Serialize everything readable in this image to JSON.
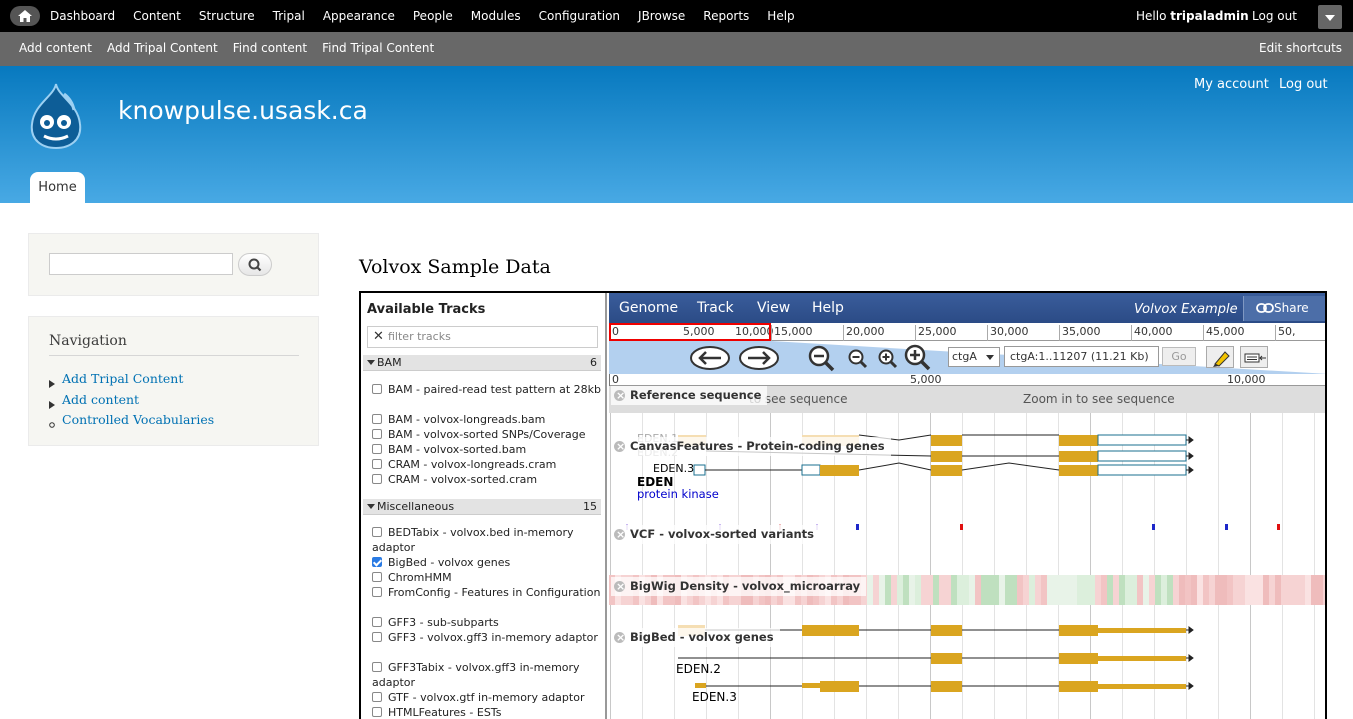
{
  "admin_bar": {
    "menu": [
      "Dashboard",
      "Content",
      "Structure",
      "Tripal",
      "Appearance",
      "People",
      "Modules",
      "Configuration",
      "JBrowse",
      "Reports",
      "Help"
    ],
    "greeting_prefix": "Hello ",
    "username": "tripaladmin",
    "logout": "Log out"
  },
  "shortcuts": {
    "links": [
      "Add content",
      "Add Tripal Content",
      "Find content",
      "Find Tripal Content"
    ],
    "edit": "Edit shortcuts"
  },
  "header": {
    "site_name": "knowpulse.usask.ca",
    "my_account": "My account",
    "log_out": "Log out",
    "home_tab": "Home"
  },
  "sidebar": {
    "search_value": "",
    "nav_title": "Navigation",
    "nav_items": [
      "Add Tripal Content",
      "Add content",
      "Controlled Vocabularies"
    ]
  },
  "page_title": "Volvox Sample Data",
  "jbrowse": {
    "available_tracks": "Available Tracks",
    "filter_placeholder": "filter tracks",
    "categories": [
      {
        "name": "BAM",
        "count": "6"
      },
      {
        "name": "Miscellaneous",
        "count": "15"
      }
    ],
    "bam_tracks": [
      {
        "label": "BAM - paired-read test pattern at 28kb",
        "checked": false
      },
      {
        "label": "BAM - volvox-longreads.bam",
        "checked": false
      },
      {
        "label": "BAM - volvox-sorted SNPs/Coverage",
        "checked": false
      },
      {
        "label": "BAM - volvox-sorted.bam",
        "checked": false
      },
      {
        "label": "CRAM - volvox-longreads.cram",
        "checked": false
      },
      {
        "label": "CRAM - volvox-sorted.cram",
        "checked": false
      }
    ],
    "misc_tracks": [
      {
        "label": "BEDTabix - volvox.bed in-memory adaptor",
        "checked": false
      },
      {
        "label": "BigBed - volvox genes",
        "checked": true
      },
      {
        "label": "ChromHMM",
        "checked": false
      },
      {
        "label": "FromConfig - Features in Configuration",
        "checked": false
      },
      {
        "label": "GFF3 - sub-subparts",
        "checked": false
      },
      {
        "label": "GFF3 - volvox.gff3 in-memory adaptor",
        "checked": false
      },
      {
        "label": "GFF3Tabix - volvox.gff3 in-memory adaptor",
        "checked": false
      },
      {
        "label": "GTF - volvox.gtf in-memory adaptor",
        "checked": false
      },
      {
        "label": "HTMLFeatures - ESTs",
        "checked": false
      }
    ],
    "menu": [
      "Genome",
      "Track",
      "View",
      "Help"
    ],
    "dataset": "Volvox Example",
    "share": "Share",
    "overview_ticks": [
      "0",
      "5,000",
      "10,000",
      "15,000",
      "20,000",
      "25,000",
      "30,000",
      "35,000",
      "40,000",
      "45,000",
      "50,"
    ],
    "ref_select": "ctgA",
    "location": "ctgA:1..11207 (11.21 Kb)",
    "go": "Go",
    "scale_ticks": [
      "0",
      "5,000",
      "10,000"
    ],
    "tracks": {
      "refseq": "Reference sequence",
      "refseq_msg_1": "to see sequence",
      "refseq_msg_2": "Zoom in to see sequence",
      "canvas": "CanvasFeatures - Protein-coding genes",
      "vcf": "VCF - volvox-sorted variants",
      "bigwig": "BigWig Density - volvox_microarray",
      "bigbed": "BigBed - volvox genes"
    },
    "feature_labels": {
      "eden1": "EDEN.1",
      "eden2": "EDEN.2",
      "eden3": "EDEN.3",
      "eden": "EDEN",
      "eden_desc": "protein kinase",
      "bb_eden2": "EDEN.2",
      "bb_eden3": "EDEN.3"
    }
  }
}
